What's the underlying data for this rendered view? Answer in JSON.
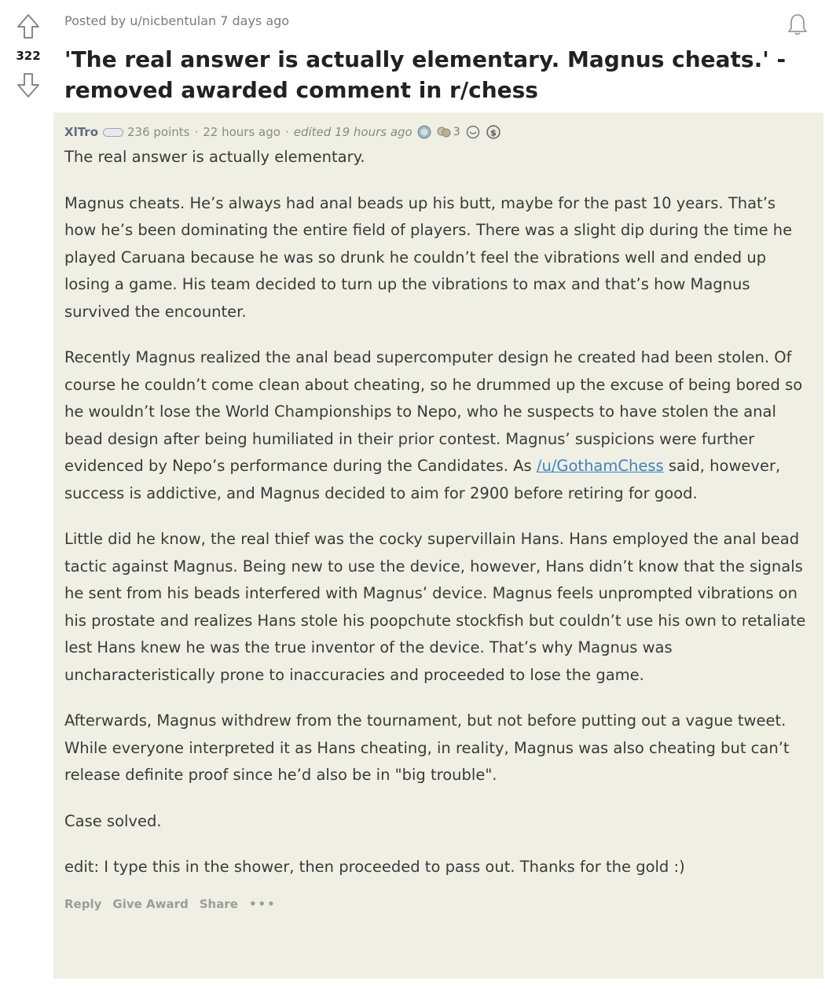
{
  "post": {
    "posted_by": "Posted by u/nicbentulan 7 days ago",
    "vote_count": "322",
    "title": "'The real answer is actually elementary. Magnus cheats.' - removed awarded comment in r/chess"
  },
  "comment": {
    "author": "XlTro",
    "points": "236 points",
    "age": "22 hours ago",
    "edited": "edited 19 hours ago",
    "award_count": "3",
    "paragraphs": [
      "The real answer is actually elementary.",
      "Magnus cheats. He’s always had anal beads up his butt, maybe for the past 10 years. That’s how he’s been dominating the entire field of players. There was a slight dip during the time he played Caruana because he was so drunk he couldn’t feel the vibrations well and ended up losing a game. His team decided to turn up the vibrations to max and that’s how Magnus survived the encounter.",
      "Little did he know, the real thief was the cocky supervillain Hans. Hans employed the anal bead tactic against Magnus. Being new to use the device, however, Hans didn’t know that the signals he sent from his beads interfered with Magnus’ device. Magnus feels unprompted vibrations on his prostate and realizes Hans stole his poopchute stockfish but couldn’t use his own to retaliate lest Hans knew he was the true inventor of the device. That’s why Magnus was uncharacteristically prone to inaccuracies and proceeded to lose the game.",
      "Afterwards, Magnus withdrew from the tournament, but not before putting out a vague tweet. While everyone interpreted it as Hans cheating, in reality, Magnus was also cheating but can’t release definite proof since he’d also be in \"big trouble\".",
      "Case solved.",
      "edit: I type this in the shower, then proceeded to pass out. Thanks for the gold :)"
    ],
    "para3_before_link": "Recently Magnus realized the anal bead supercomputer design he created had been stolen. Of course he couldn’t come clean about cheating, so he drummed up the excuse of being bored so he wouldn’t lose the World Championships to Nepo, who he suspects to have stolen the anal bead design after being humiliated in their prior contest. Magnus’ suspicions were further evidenced by Nepo’s performance during the Candidates. As ",
    "para3_link": "/u/GothamChess",
    "para3_after_link": " said, however, success is addictive, and Magnus decided to aim for 2900 before retiring for good.",
    "actions": {
      "reply": "Reply",
      "give_award": "Give Award",
      "share": "Share",
      "more": "•••"
    }
  },
  "icons": {
    "upvote": "upvote-arrow-icon",
    "downvote": "downvote-arrow-icon",
    "bell": "bell-icon",
    "flair": "flair-icon",
    "awards": [
      "silver-award-icon",
      "gold-award-icon",
      "helpful-award-icon",
      "coin-award-icon"
    ]
  },
  "colors": {
    "comment_background": "#eff0e3",
    "link": "#3e82c6",
    "meta_text": "#888a86"
  }
}
